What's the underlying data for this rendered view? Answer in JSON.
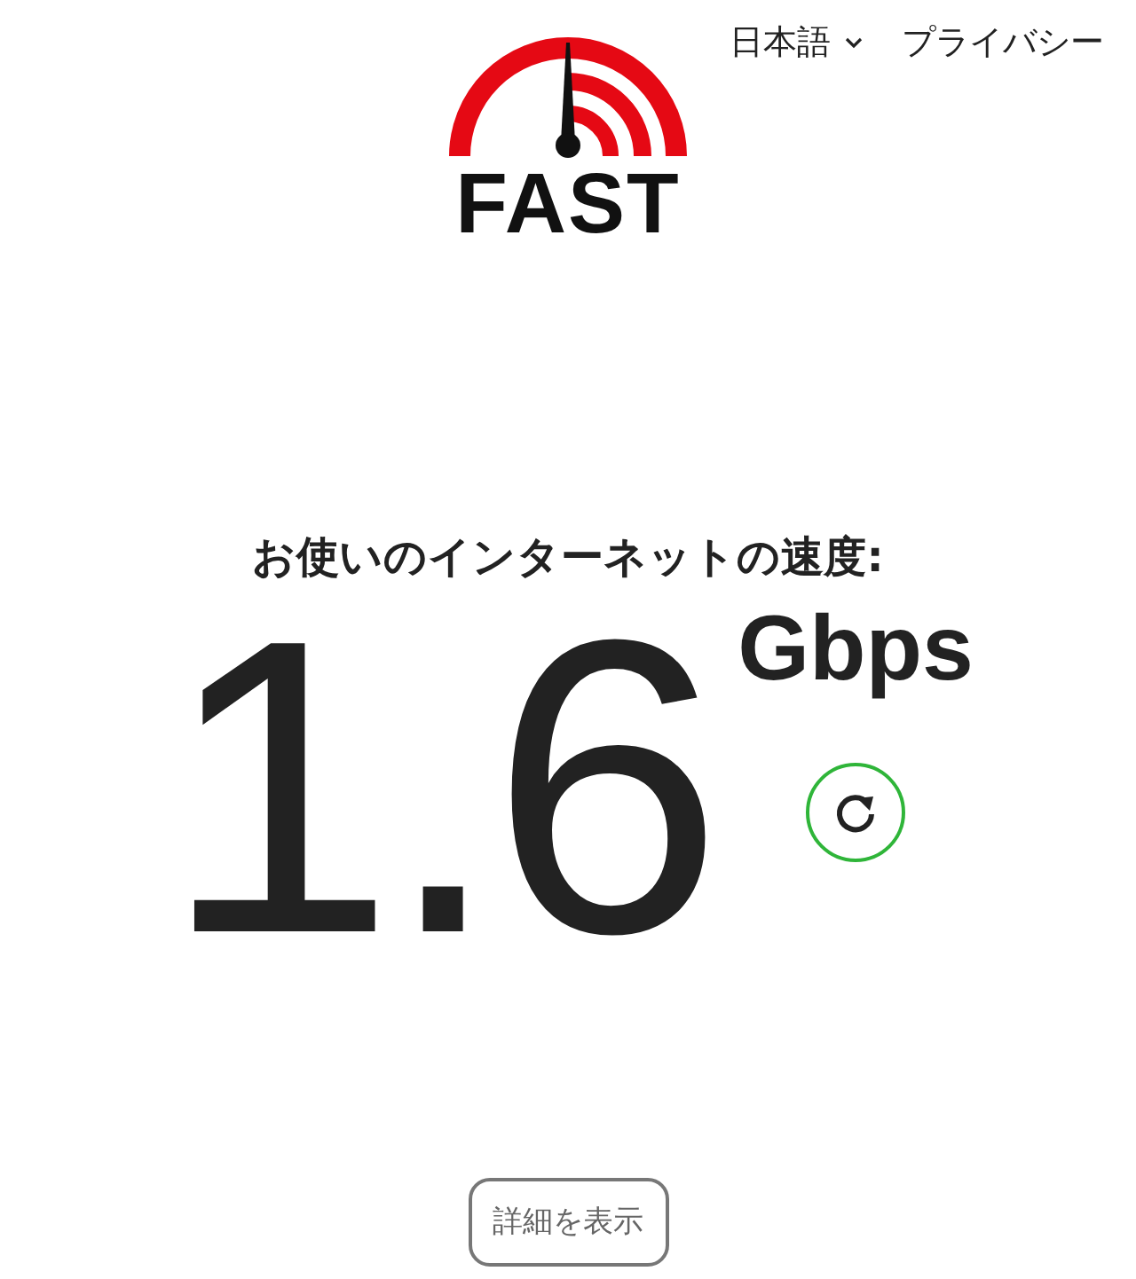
{
  "nav": {
    "language": "日本語",
    "privacy": "プライバシー"
  },
  "logo": {
    "text": "FAST"
  },
  "heading": "お使いのインターネットの速度:",
  "speed": {
    "value": "1.6",
    "unit": "Gbps"
  },
  "details_button": "詳細を表示"
}
